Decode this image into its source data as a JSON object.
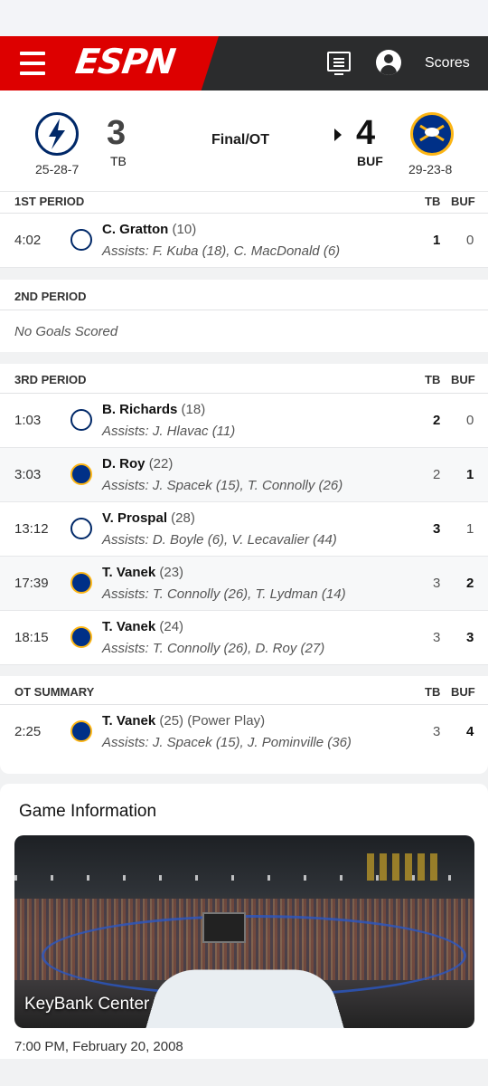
{
  "header": {
    "logo_text": "ESPN",
    "scores_label": "Scores",
    "icons": [
      "menu-icon",
      "tv-guide-icon",
      "account-icon"
    ]
  },
  "game": {
    "away": {
      "abbr": "TB",
      "score": "3",
      "record": "25-28-7",
      "logo": "tampa-bay-lightning-logo"
    },
    "home": {
      "abbr": "BUF",
      "score": "4",
      "record": "29-23-8",
      "logo": "buffalo-sabres-logo"
    },
    "status": "Final/OT"
  },
  "colors": {
    "espn_red": "#dd0000",
    "topbar": "#2b2c2d",
    "tb_blue": "#002868",
    "buf_blue": "#003087",
    "buf_gold": "#fcb514"
  },
  "periods": [
    {
      "label": "1ST PERIOD",
      "col_tb": "TB",
      "col_buf": "BUF",
      "goals": [
        {
          "time": "4:02",
          "team": "TB",
          "scorer": "C. Gratton",
          "count": "(10)",
          "assists": "Assists: F. Kuba (18), C. MacDonald (6)",
          "tb": "1",
          "buf": "0"
        }
      ]
    },
    {
      "label": "2ND PERIOD",
      "no_goals": "No Goals Scored"
    },
    {
      "label": "3RD PERIOD",
      "col_tb": "TB",
      "col_buf": "BUF",
      "goals": [
        {
          "time": "1:03",
          "team": "TB",
          "scorer": "B. Richards",
          "count": "(18)",
          "assists": "Assists: J. Hlavac (11)",
          "tb": "2",
          "buf": "0"
        },
        {
          "time": "3:03",
          "team": "BUF",
          "scorer": "D. Roy",
          "count": "(22)",
          "assists": "Assists: J. Spacek (15), T. Connolly (26)",
          "tb": "2",
          "buf": "1"
        },
        {
          "time": "13:12",
          "team": "TB",
          "scorer": "V. Prospal",
          "count": "(28)",
          "assists": "Assists: D. Boyle (6), V. Lecavalier (44)",
          "tb": "3",
          "buf": "1"
        },
        {
          "time": "17:39",
          "team": "BUF",
          "scorer": "T. Vanek",
          "count": "(23)",
          "assists": "Assists: T. Connolly (26), T. Lydman (14)",
          "tb": "3",
          "buf": "2"
        },
        {
          "time": "18:15",
          "team": "BUF",
          "scorer": "T. Vanek",
          "count": "(24)",
          "assists": "Assists: T. Connolly (26), D. Roy (27)",
          "tb": "3",
          "buf": "3"
        }
      ]
    },
    {
      "label": "OT SUMMARY",
      "col_tb": "TB",
      "col_buf": "BUF",
      "goals": [
        {
          "time": "2:25",
          "team": "BUF",
          "scorer": "T. Vanek",
          "count": "(25) (Power Play)",
          "assists": "Assists: J. Spacek (15), J. Pominville (36)",
          "tb": "3",
          "buf": "4"
        }
      ]
    }
  ],
  "game_info": {
    "title": "Game Information",
    "venue": "KeyBank Center",
    "datetime": "7:00 PM, February 20, 2008"
  }
}
